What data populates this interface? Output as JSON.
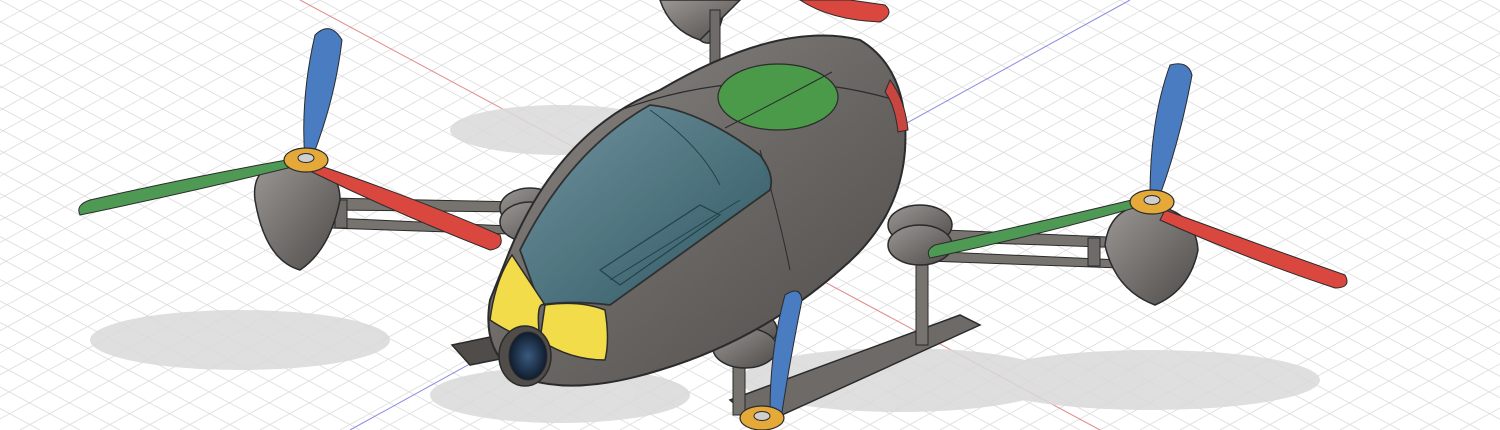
{
  "viewport": {
    "background": "#ffffff",
    "grid_color": "#dcdcdc",
    "axis_x_color": "#e38a8a",
    "axis_y_color": "#8a8ae3"
  },
  "model": {
    "body_color": "#676461",
    "body_highlight": "#8a8785",
    "body_edge": "#2b2b2b",
    "canopy_color": "#3f6f7c",
    "nose_color": "#f2dc4a",
    "top_marker_color": "#4a9a4a",
    "rear_light_color": "#c9453f",
    "camera_lens_color": "#1f3550",
    "shadow_color": "#d9d9d9"
  },
  "propellers": {
    "hub_color": "#e5a93a",
    "blade_colors": {
      "front": "#d9473f",
      "back": "#4a7cc2",
      "side": "#4e9a55"
    },
    "count": 4
  }
}
